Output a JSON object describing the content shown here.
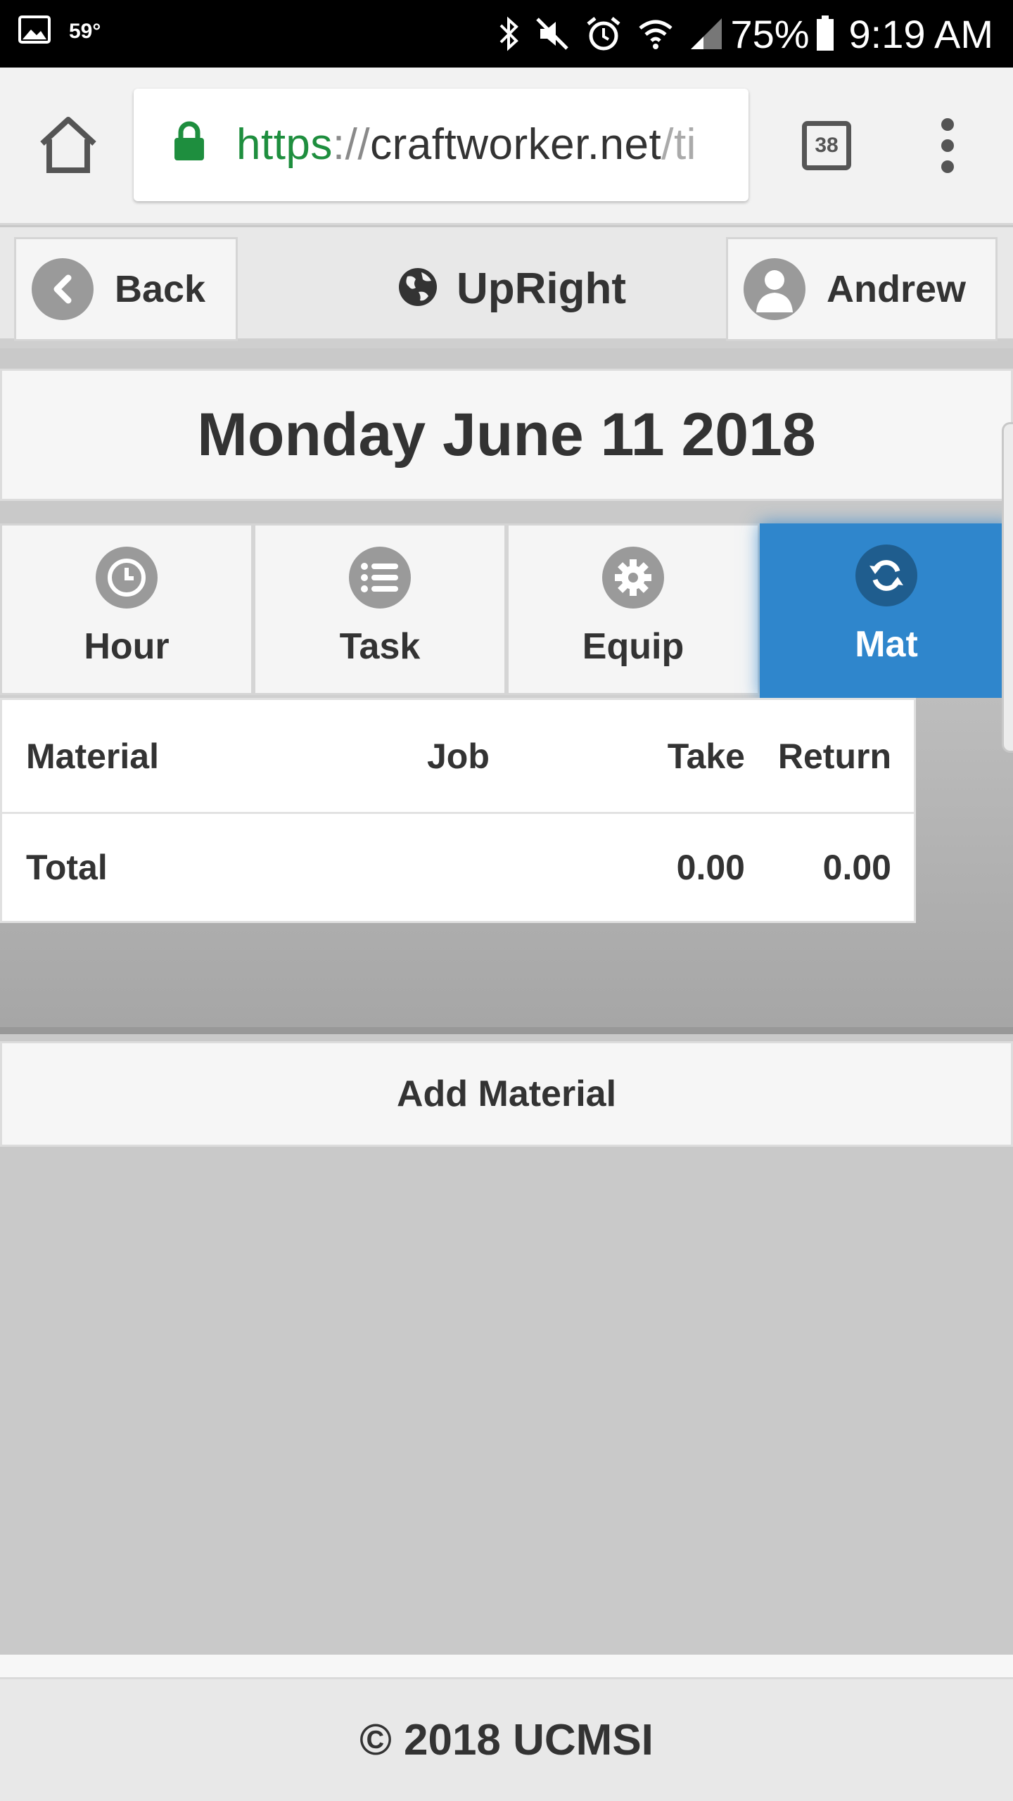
{
  "status_bar": {
    "temperature": "59°",
    "battery": "75%",
    "time": "9:19 AM",
    "icons": [
      "gallery-icon",
      "bluetooth-icon",
      "mute-icon",
      "alarm-icon",
      "wifi-icon",
      "signal-icon",
      "battery-icon"
    ]
  },
  "browser": {
    "url_scheme": "https",
    "url_sep": "://",
    "url_host": "craftworker.net",
    "url_rest": "/ti",
    "tab_count": "38"
  },
  "header": {
    "back_label": "Back",
    "brand": "UpRight",
    "user_label": "Andrew"
  },
  "date": "Monday June 11 2018",
  "tabs": [
    {
      "label": "Hour",
      "icon": "clock-icon"
    },
    {
      "label": "Task",
      "icon": "list-icon"
    },
    {
      "label": "Equip",
      "icon": "gear-icon"
    },
    {
      "label": "Mat",
      "icon": "refresh-icon",
      "active": true
    }
  ],
  "table": {
    "headers": {
      "material": "Material",
      "job": "Job",
      "take": "Take",
      "return": "Return"
    },
    "total": {
      "label": "Total",
      "take": "0.00",
      "return": "0.00"
    }
  },
  "add_material": "Add Material",
  "footer": "© 2018 UCMSI",
  "colors": {
    "accent": "#2f86cc",
    "lock_green": "#1e8e3e"
  }
}
